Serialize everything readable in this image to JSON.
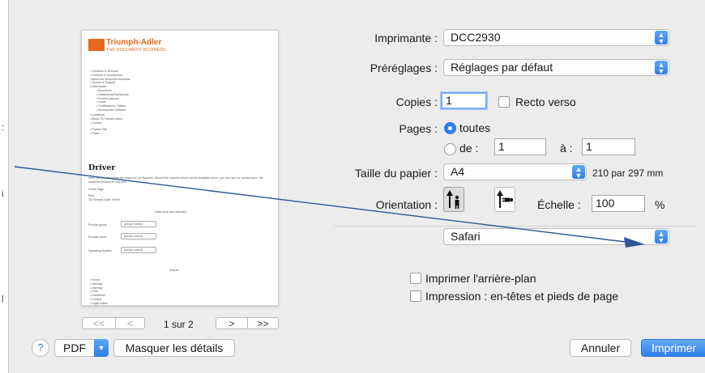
{
  "side_marks": [
    ":",
    "i",
    "l"
  ],
  "preview": {
    "logo": {
      "name": "Triumph-Adler",
      "tagline": "THE DOCUMENT BUSINESS"
    },
    "menu_items": [
      "Solutions & Services",
      "Products & Accessories",
      "About the document business",
      "Service & Support",
      "Downloads"
    ],
    "sub_items": [
      "Brochures",
      "Datasheets/Handbooks",
      "Product pictures",
      "Driver",
      "Certifications / Safety",
      "Accessories Software"
    ],
    "more_items": [
      "Locations",
      "About TA Triumph-Adler",
      "Contact"
    ],
    "short_items": [
      "Partner Site",
      "Press"
    ],
    "heading": "Driver",
    "intro_text": "Here you can download the drivers of our systems. Should the required driver not be available online, you can use our contact form. We would be pleased to help you.",
    "breadcrumb": "Home Page",
    "location_lines": [
      "Print",
      "TA Triumph-Adler GmbH"
    ],
    "select_title": "Make your own selection",
    "form_rows": [
      {
        "label": "Product group",
        "value": "(please select)"
      },
      {
        "label": "Product name",
        "value": "(please select)"
      },
      {
        "label": "Operating System",
        "value": "(please select)"
      }
    ],
    "search_label": "Search",
    "footer_items": [
      "Home",
      "Sitemap",
      "Sitemap",
      "Print",
      "Disclaimer",
      "Contact",
      "Legal notice"
    ]
  },
  "pagination": {
    "first": "<<",
    "prev": "<",
    "next": ">",
    "last": ">>",
    "page_label": "1 sur 2"
  },
  "form": {
    "printer": {
      "label": "Imprimante :",
      "value": "DCC2930"
    },
    "presets": {
      "label": "Préréglages :",
      "value": "Réglages par défaut"
    },
    "copies": {
      "label": "Copies :",
      "value": "1",
      "duplex_label": "Recto verso",
      "duplex_checked": false
    },
    "pages": {
      "label": "Pages :",
      "all_label": "toutes",
      "from_label": "de :",
      "from_value": "1",
      "to_label": "à :",
      "to_value": "1",
      "selected": "toutes"
    },
    "paper_size": {
      "label": "Taille du papier :",
      "value": "A4",
      "dimensions": "210 par 297 mm"
    },
    "orientation": {
      "label": "Orientation :",
      "selected": "portrait"
    },
    "scale": {
      "label": "Échelle :",
      "value": "100",
      "unit": "%"
    },
    "section": {
      "value": "Safari"
    },
    "print_background": {
      "label": "Imprimer l'arrière-plan",
      "checked": false
    },
    "headers_footers": {
      "label": "Impression : en-têtes et pieds de page",
      "checked": false
    }
  },
  "footer": {
    "help_label": "?",
    "pdf_label": "PDF",
    "details_label": "Masquer les détails",
    "cancel_label": "Annuler",
    "print_label": "Imprimer"
  },
  "icons": {
    "stepper": "up-down-arrows-icon",
    "portrait": "portrait-orientation-icon",
    "landscape": "landscape-orientation-icon",
    "pdf_menu": "chevron-down-icon",
    "help": "question-mark-icon"
  },
  "colors": {
    "dialog_bg": "#ececec",
    "accent_blue": "#2f7ee8",
    "focus_ring": "#79adf2",
    "logo_orange": "#e8681e",
    "annotation_arrow": "#2f5597"
  }
}
